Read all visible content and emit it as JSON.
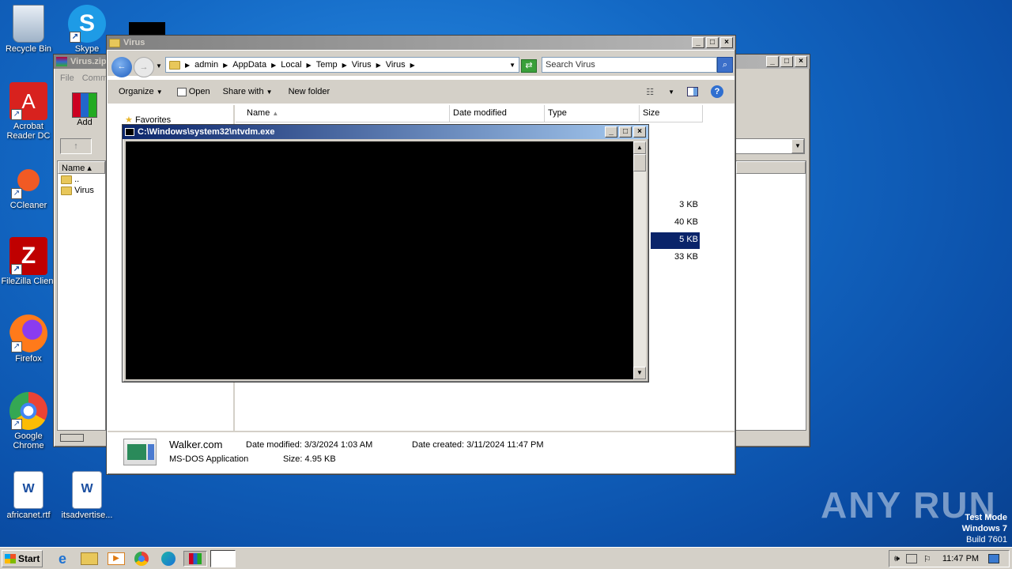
{
  "desktop": {
    "icons": [
      {
        "label": "Recycle Bin"
      },
      {
        "label": "Skype"
      },
      {
        "label": "Acrobat Reader DC"
      },
      {
        "label": "CCleaner"
      },
      {
        "label": "FileZilla Client"
      },
      {
        "label": "Firefox"
      },
      {
        "label": "Google Chrome"
      },
      {
        "label": "africanet.rtf"
      },
      {
        "label": "itsadvertise..."
      }
    ],
    "watermark": "ANY RUN",
    "os": {
      "line1": "Test Mode",
      "line2": "Windows 7",
      "line3": "Build 7601"
    }
  },
  "winrar": {
    "title": "Virus.zip",
    "menu": [
      "File",
      "Comm"
    ],
    "add_label": "Add",
    "col_name": "Name",
    "rows": [
      "..",
      "Virus"
    ]
  },
  "explorer": {
    "title": "Virus",
    "breadcrumb": [
      "admin",
      "AppData",
      "Local",
      "Temp",
      "Virus",
      "Virus"
    ],
    "search_placeholder": "Search Virus",
    "toolbar": {
      "organize": "Organize",
      "open": "Open",
      "share_with": "Share with",
      "new_folder": "New folder"
    },
    "columns": {
      "name": "Name",
      "date_modified": "Date modified",
      "type": "Type",
      "size": "Size"
    },
    "nav": {
      "favorites": "Favorites"
    },
    "sizes": [
      "3 KB",
      "40 KB",
      "5 KB",
      "33 KB"
    ],
    "selected_index": 2,
    "details": {
      "filename": "Walker.com",
      "filetype": "MS-DOS Application",
      "date_modified_label": "Date modified:",
      "date_modified": "3/3/2024 1:03 AM",
      "size_label": "Size:",
      "size": "4.95 KB",
      "date_created_label": "Date created:",
      "date_created": "3/11/2024 11:47 PM"
    }
  },
  "console": {
    "title": "C:\\Windows\\system32\\ntvdm.exe"
  },
  "taskbar": {
    "start_label": "Start",
    "clock": "11:47 PM"
  },
  "colors": {
    "accent": "#0a246a",
    "selection": "#0a246a"
  }
}
